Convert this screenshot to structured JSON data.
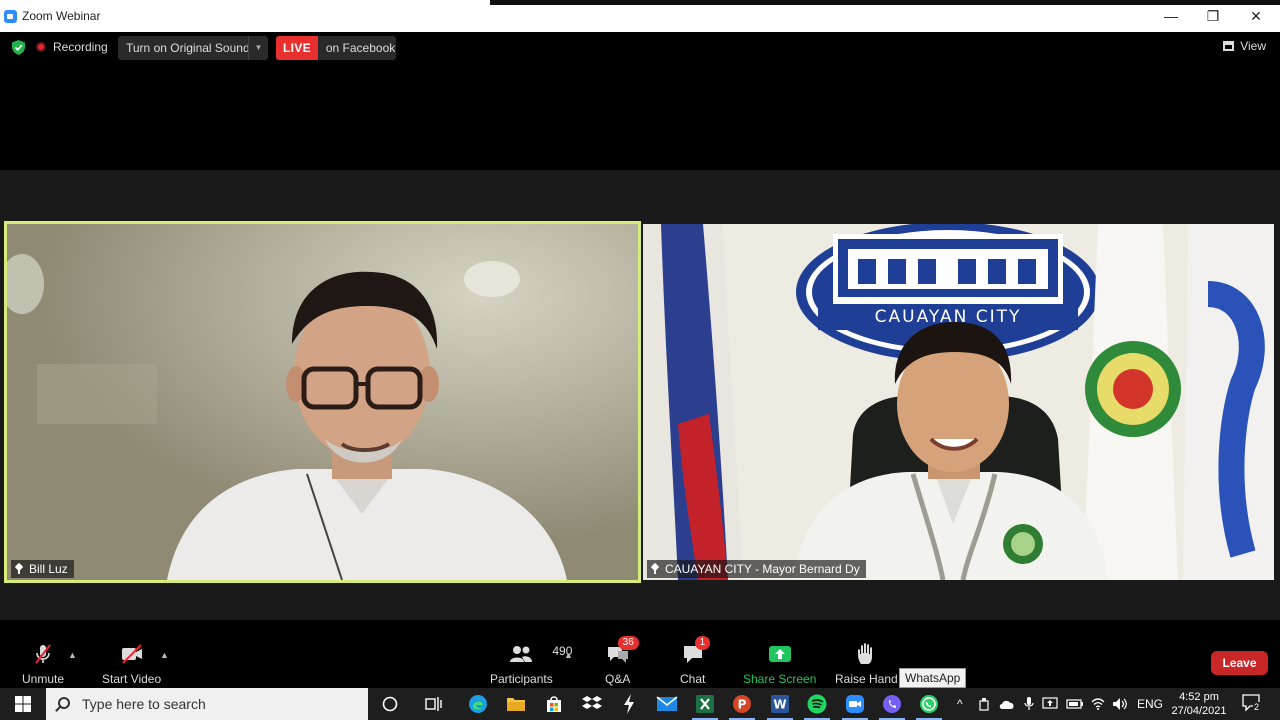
{
  "window": {
    "title": "Zoom Webinar",
    "minimize": "—",
    "restore": "❐",
    "close": "✕"
  },
  "topbar": {
    "recording_label": "Recording",
    "original_sound_label": "Turn on Original Sound",
    "live_badge": "LIVE",
    "live_destination": "on Facebook",
    "view_label": "View"
  },
  "videos": [
    {
      "name": "Bill Luz",
      "active_speaker": true
    },
    {
      "name": "CAUAYAN CITY - Mayor Bernard Dy",
      "active_speaker": false,
      "backdrop_text": "CAUAYAN CITY"
    }
  ],
  "toolbar": {
    "unmute": "Unmute",
    "start_video": "Start Video",
    "participants_count": "490",
    "participants": "Participants",
    "qa": "Q&A",
    "qa_badge": "36",
    "chat": "Chat",
    "chat_badge": "1",
    "share_screen": "Share Screen",
    "raise_hand": "Raise Hand",
    "leave": "Leave",
    "tooltip": "WhatsApp"
  },
  "taskbar": {
    "search_placeholder": "Type here to search",
    "language": "ENG",
    "time": "4:52 pm",
    "date": "27/04/2021",
    "notification_count": "2",
    "apps": [
      "cortana-icon",
      "task-view-icon",
      "edge-icon",
      "file-explorer-icon",
      "store-icon",
      "dropbox-icon",
      "zap-icon",
      "mail-icon",
      "excel-icon",
      "powerpoint-icon",
      "word-icon",
      "spotify-icon",
      "zoom-icon",
      "viber-icon",
      "whatsapp-icon"
    ]
  },
  "colors": {
    "active_speaker_border": "#d8ec7a",
    "live_red": "#e8302f",
    "leave_red": "#c92727",
    "share_green": "#22c55e"
  }
}
